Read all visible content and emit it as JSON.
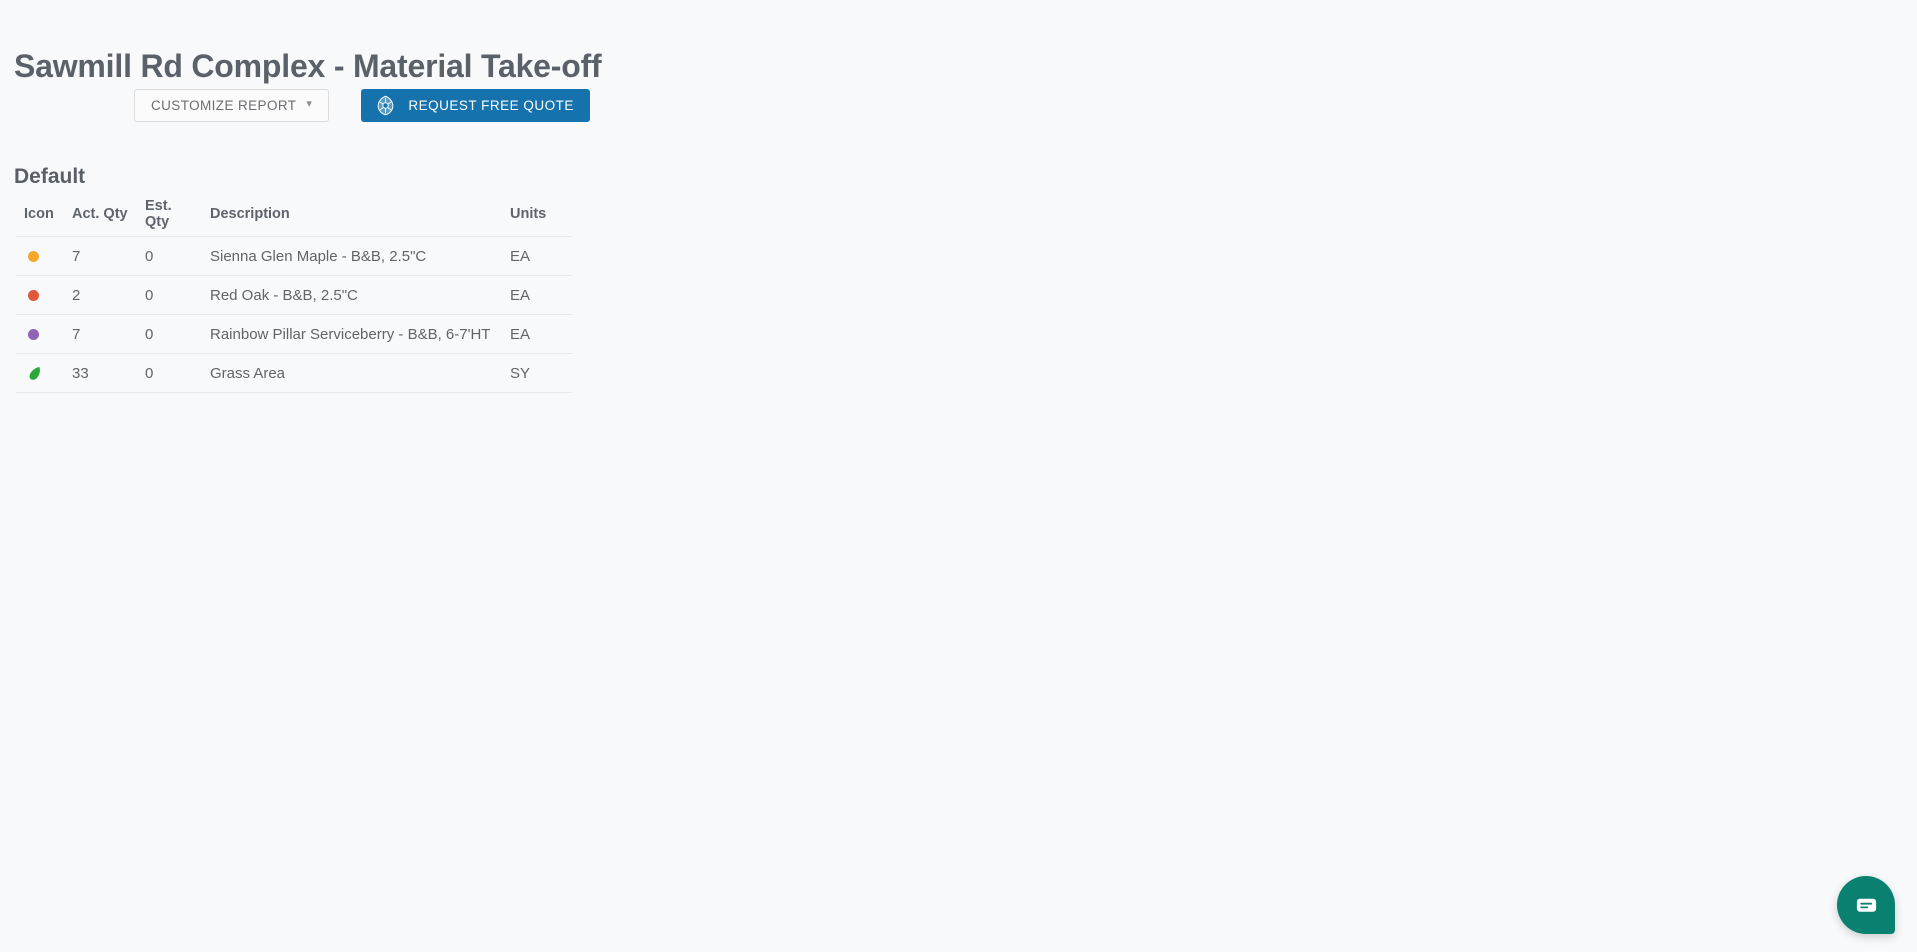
{
  "page": {
    "title": "Sawmill Rd Complex - Material Take-off",
    "background_color": "#f8f9fb"
  },
  "toolbar": {
    "customize_report_label": "CUSTOMIZE REPORT",
    "customize_caret_icon": "chevron-down-icon",
    "request_quote_label": "REQUEST FREE QUOTE",
    "request_quote_icon": "leaf-logo-icon",
    "request_quote_color": "#1572ac"
  },
  "report": {
    "section_title": "Default",
    "table": {
      "columns": [
        "Icon",
        "Act. Qty",
        "Est. Qty",
        "Description",
        "Units"
      ],
      "rows": [
        {
          "icon": "orange-dot-icon",
          "icon_color": "#f5a72c",
          "act_qty": "7",
          "est_qty": "0",
          "description": "Sienna Glen Maple - B&B, 2.5\"C",
          "units": "EA"
        },
        {
          "icon": "red-dot-icon",
          "icon_color": "#e0573c",
          "act_qty": "2",
          "est_qty": "0",
          "description": "Red Oak - B&B, 2.5\"C",
          "units": "EA"
        },
        {
          "icon": "purple-dot-icon",
          "icon_color": "#9063b8",
          "act_qty": "7",
          "est_qty": "0",
          "description": "Rainbow Pillar Serviceberry - B&B, 6-7'HT",
          "units": "EA"
        },
        {
          "icon": "green-grass-leaf-icon",
          "icon_color": "#2aa63a",
          "act_qty": "33",
          "est_qty": "0",
          "description": "Grass Area",
          "units": "SY"
        }
      ]
    }
  },
  "chat": {
    "icon": "chat-bubble-icon",
    "color": "#0a8070"
  }
}
